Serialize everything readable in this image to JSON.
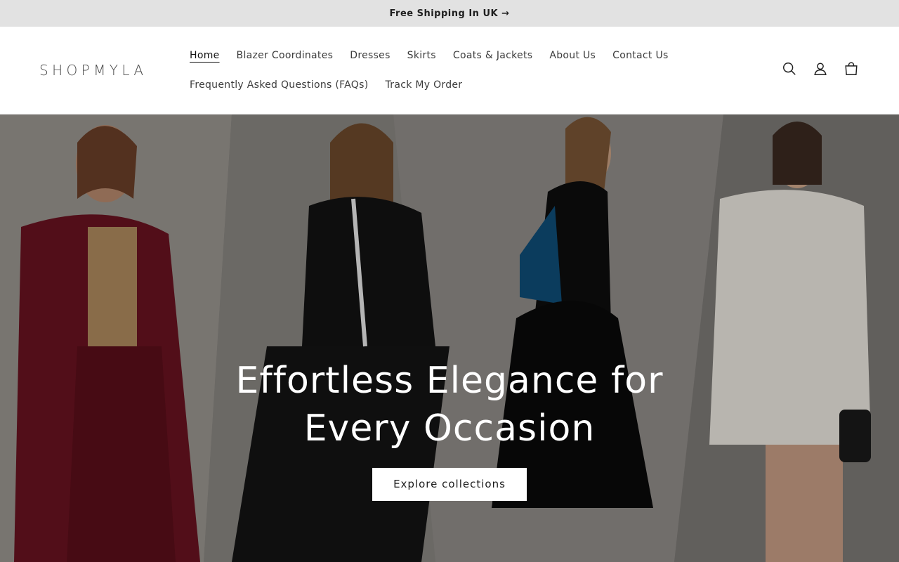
{
  "announcement": {
    "text": "Free Shipping In UK →"
  },
  "brand": {
    "logo": "SHOPMYLA"
  },
  "nav": {
    "row1": [
      "Home",
      "Blazer Coordinates",
      "Dresses",
      "Skirts",
      "Coats & Jackets",
      "About Us",
      "Contact Us"
    ],
    "row2": [
      "Frequently Asked Questions (FAQs)",
      "Track My Order"
    ],
    "active": "Home"
  },
  "header_icons": [
    "search-icon",
    "account-icon",
    "cart-icon"
  ],
  "hero": {
    "title": "Effortless Elegance for Every Occasion",
    "button_label": "Explore collections"
  },
  "colors": {
    "announcement_bg": "#e2e2e2",
    "button_bg": "#ffffff",
    "hero_text": "#ffffff"
  }
}
